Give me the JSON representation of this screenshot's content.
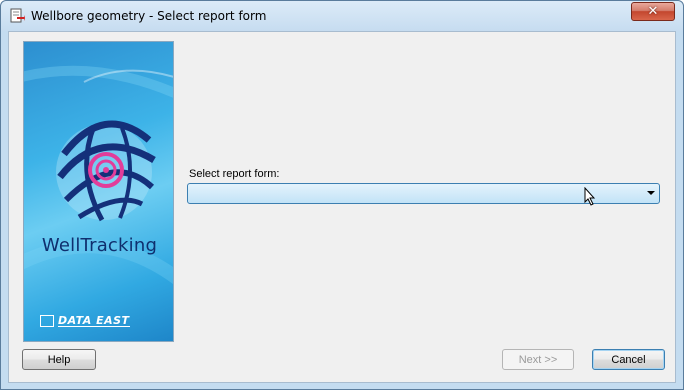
{
  "window": {
    "title": "Wellbore geometry - Select report form",
    "close_label": "✕"
  },
  "banner": {
    "brand": "WellTracking",
    "vendor": "DATA EAST"
  },
  "form": {
    "label": "Select report form:",
    "selected_value": ""
  },
  "buttons": {
    "help": "Help",
    "next": "Next >>",
    "cancel": "Cancel"
  },
  "colors": {
    "title_bar": "#c6dcf0",
    "close_button": "#c3462e",
    "banner_blue": "#3db3e8",
    "brand_text": "#0f2f6e",
    "dropdown_fill": "#c2e3f7"
  }
}
